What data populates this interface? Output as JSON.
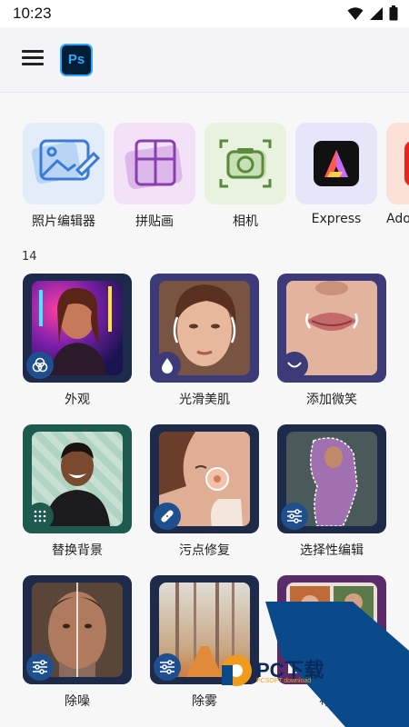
{
  "status_bar": {
    "time": "10:23",
    "icons": [
      "wifi-icon",
      "signal-icon",
      "battery-icon"
    ]
  },
  "app_bar": {
    "menu_icon": "hamburger-menu-icon",
    "logo_text": "Ps"
  },
  "quick_actions": [
    {
      "label": "照片编辑器",
      "icon": "photo-edit-icon"
    },
    {
      "label": "拼贴画",
      "icon": "collage-grid-icon"
    },
    {
      "label": "相机",
      "icon": "camera-icon"
    },
    {
      "label": "Express",
      "icon": "adobe-express-icon"
    },
    {
      "label": "Ado",
      "icon": "adobe-app-icon"
    }
  ],
  "section": {
    "label": "14"
  },
  "features": [
    {
      "label": "外观",
      "badge_icon": "filters-icon"
    },
    {
      "label": "光滑美肌",
      "badge_icon": "droplet-icon"
    },
    {
      "label": "添加微笑",
      "badge_icon": "smile-icon"
    },
    {
      "label": "替换背景",
      "badge_icon": "background-pattern-icon"
    },
    {
      "label": "污点修复",
      "badge_icon": "bandage-icon"
    },
    {
      "label": "选择性编辑",
      "badge_icon": "sliders-icon"
    },
    {
      "label": "除噪",
      "badge_icon": "sliders-icon"
    },
    {
      "label": "除雾",
      "badge_icon": "sliders-icon"
    },
    {
      "label": "布局",
      "badge_icon": "layout-icon"
    }
  ],
  "watermark": {
    "text": "PC下载",
    "subtext": "PCSOFT download"
  },
  "colors": {
    "background": "#f7f7f8",
    "ps_blue": "#31a8ff",
    "ps_dark": "#001e36",
    "tile_navy": "#1e2a4a",
    "watermark_blue": "#0a4a8a"
  }
}
